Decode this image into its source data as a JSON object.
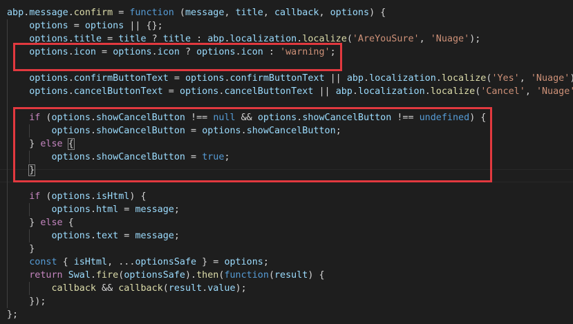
{
  "colors": {
    "background": "#1e1e1e",
    "highlight_box": "#e2393f",
    "identifier": "#9cdcfe",
    "function_name": "#dcdcaa",
    "keyword_control": "#c586c0",
    "keyword_storage": "#569cd6",
    "string": "#ce9178",
    "punctuation": "#d4d4d4",
    "class_name": "#4ec9b0"
  },
  "code_lines": [
    {
      "indent": 0,
      "tokens": [
        {
          "t": "abp",
          "c": "identifier"
        },
        {
          "t": ".",
          "c": "punctuation"
        },
        {
          "t": "message",
          "c": "identifier"
        },
        {
          "t": ".",
          "c": "punctuation"
        },
        {
          "t": "confirm",
          "c": "function_name"
        },
        {
          "t": " = ",
          "c": "punctuation"
        },
        {
          "t": "function",
          "c": "keyword_storage"
        },
        {
          "t": " (",
          "c": "punctuation"
        },
        {
          "t": "message",
          "c": "identifier"
        },
        {
          "t": ", ",
          "c": "punctuation"
        },
        {
          "t": "title",
          "c": "identifier"
        },
        {
          "t": ", ",
          "c": "punctuation"
        },
        {
          "t": "callback",
          "c": "identifier"
        },
        {
          "t": ", ",
          "c": "punctuation"
        },
        {
          "t": "options",
          "c": "identifier"
        },
        {
          "t": ") {",
          "c": "punctuation"
        }
      ]
    },
    {
      "indent": 1,
      "tokens": [
        {
          "t": "options",
          "c": "identifier"
        },
        {
          "t": " = ",
          "c": "punctuation"
        },
        {
          "t": "options",
          "c": "identifier"
        },
        {
          "t": " || {};",
          "c": "punctuation"
        }
      ]
    },
    {
      "indent": 1,
      "tokens": [
        {
          "t": "options",
          "c": "identifier"
        },
        {
          "t": ".",
          "c": "punctuation"
        },
        {
          "t": "title",
          "c": "identifier"
        },
        {
          "t": " = ",
          "c": "punctuation"
        },
        {
          "t": "title",
          "c": "identifier"
        },
        {
          "t": " ? ",
          "c": "punctuation"
        },
        {
          "t": "title",
          "c": "identifier"
        },
        {
          "t": " : ",
          "c": "punctuation"
        },
        {
          "t": "abp",
          "c": "identifier"
        },
        {
          "t": ".",
          "c": "punctuation"
        },
        {
          "t": "localization",
          "c": "identifier"
        },
        {
          "t": ".",
          "c": "punctuation"
        },
        {
          "t": "localize",
          "c": "function_name"
        },
        {
          "t": "(",
          "c": "punctuation"
        },
        {
          "t": "'AreYouSure'",
          "c": "string"
        },
        {
          "t": ", ",
          "c": "punctuation"
        },
        {
          "t": "'Nuage'",
          "c": "string"
        },
        {
          "t": ");",
          "c": "punctuation"
        }
      ]
    },
    {
      "indent": 1,
      "tokens": [
        {
          "t": "options",
          "c": "identifier"
        },
        {
          "t": ".",
          "c": "punctuation"
        },
        {
          "t": "icon",
          "c": "identifier"
        },
        {
          "t": " = ",
          "c": "punctuation"
        },
        {
          "t": "options",
          "c": "identifier"
        },
        {
          "t": ".",
          "c": "punctuation"
        },
        {
          "t": "icon",
          "c": "identifier"
        },
        {
          "t": " ? ",
          "c": "punctuation"
        },
        {
          "t": "options",
          "c": "identifier"
        },
        {
          "t": ".",
          "c": "punctuation"
        },
        {
          "t": "icon",
          "c": "identifier"
        },
        {
          "t": " : ",
          "c": "punctuation"
        },
        {
          "t": "'warning'",
          "c": "string"
        },
        {
          "t": ";",
          "c": "punctuation"
        }
      ]
    },
    {
      "indent": 0,
      "tokens": []
    },
    {
      "indent": 1,
      "tokens": [
        {
          "t": "options",
          "c": "identifier"
        },
        {
          "t": ".",
          "c": "punctuation"
        },
        {
          "t": "confirmButtonText",
          "c": "identifier"
        },
        {
          "t": " = ",
          "c": "punctuation"
        },
        {
          "t": "options",
          "c": "identifier"
        },
        {
          "t": ".",
          "c": "punctuation"
        },
        {
          "t": "confirmButtonText",
          "c": "identifier"
        },
        {
          "t": " || ",
          "c": "punctuation"
        },
        {
          "t": "abp",
          "c": "identifier"
        },
        {
          "t": ".",
          "c": "punctuation"
        },
        {
          "t": "localization",
          "c": "identifier"
        },
        {
          "t": ".",
          "c": "punctuation"
        },
        {
          "t": "localize",
          "c": "function_name"
        },
        {
          "t": "(",
          "c": "punctuation"
        },
        {
          "t": "'Yes'",
          "c": "string"
        },
        {
          "t": ", ",
          "c": "punctuation"
        },
        {
          "t": "'Nuage'",
          "c": "string"
        },
        {
          "t": ");",
          "c": "punctuation"
        }
      ]
    },
    {
      "indent": 1,
      "tokens": [
        {
          "t": "options",
          "c": "identifier"
        },
        {
          "t": ".",
          "c": "punctuation"
        },
        {
          "t": "cancelButtonText",
          "c": "identifier"
        },
        {
          "t": " = ",
          "c": "punctuation"
        },
        {
          "t": "options",
          "c": "identifier"
        },
        {
          "t": ".",
          "c": "punctuation"
        },
        {
          "t": "cancelButtonText",
          "c": "identifier"
        },
        {
          "t": " || ",
          "c": "punctuation"
        },
        {
          "t": "abp",
          "c": "identifier"
        },
        {
          "t": ".",
          "c": "punctuation"
        },
        {
          "t": "localization",
          "c": "identifier"
        },
        {
          "t": ".",
          "c": "punctuation"
        },
        {
          "t": "localize",
          "c": "function_name"
        },
        {
          "t": "(",
          "c": "punctuation"
        },
        {
          "t": "'Cancel'",
          "c": "string"
        },
        {
          "t": ", ",
          "c": "punctuation"
        },
        {
          "t": "'Nuage'",
          "c": "string"
        },
        {
          "t": ");",
          "c": "punctuation"
        }
      ]
    },
    {
      "indent": 0,
      "tokens": []
    },
    {
      "indent": 1,
      "tokens": [
        {
          "t": "if",
          "c": "keyword_control"
        },
        {
          "t": " (",
          "c": "punctuation"
        },
        {
          "t": "options",
          "c": "identifier"
        },
        {
          "t": ".",
          "c": "punctuation"
        },
        {
          "t": "showCancelButton",
          "c": "identifier"
        },
        {
          "t": " !== ",
          "c": "punctuation"
        },
        {
          "t": "null",
          "c": "keyword_storage"
        },
        {
          "t": " && ",
          "c": "punctuation"
        },
        {
          "t": "options",
          "c": "identifier"
        },
        {
          "t": ".",
          "c": "punctuation"
        },
        {
          "t": "showCancelButton",
          "c": "identifier"
        },
        {
          "t": " !== ",
          "c": "punctuation"
        },
        {
          "t": "undefined",
          "c": "keyword_storage"
        },
        {
          "t": ") {",
          "c": "punctuation"
        }
      ]
    },
    {
      "indent": 2,
      "tokens": [
        {
          "t": "options",
          "c": "identifier"
        },
        {
          "t": ".",
          "c": "punctuation"
        },
        {
          "t": "showCancelButton",
          "c": "identifier"
        },
        {
          "t": " = ",
          "c": "punctuation"
        },
        {
          "t": "options",
          "c": "identifier"
        },
        {
          "t": ".",
          "c": "punctuation"
        },
        {
          "t": "showCancelButton",
          "c": "identifier"
        },
        {
          "t": ";",
          "c": "punctuation"
        }
      ]
    },
    {
      "indent": 1,
      "tokens": [
        {
          "t": "} ",
          "c": "punctuation"
        },
        {
          "t": "else",
          "c": "keyword_control"
        },
        {
          "t": " ",
          "c": "punctuation"
        },
        {
          "t": "{",
          "c": "punctuation",
          "match": true
        }
      ]
    },
    {
      "indent": 2,
      "tokens": [
        {
          "t": "options",
          "c": "identifier"
        },
        {
          "t": ".",
          "c": "punctuation"
        },
        {
          "t": "showCancelButton",
          "c": "identifier"
        },
        {
          "t": " = ",
          "c": "punctuation"
        },
        {
          "t": "true",
          "c": "keyword_storage"
        },
        {
          "t": ";",
          "c": "punctuation"
        }
      ]
    },
    {
      "indent": 1,
      "tokens": [
        {
          "t": "}",
          "c": "punctuation",
          "match": true
        }
      ]
    },
    {
      "indent": 0,
      "tokens": []
    },
    {
      "indent": 1,
      "tokens": [
        {
          "t": "if",
          "c": "keyword_control"
        },
        {
          "t": " (",
          "c": "punctuation"
        },
        {
          "t": "options",
          "c": "identifier"
        },
        {
          "t": ".",
          "c": "punctuation"
        },
        {
          "t": "isHtml",
          "c": "identifier"
        },
        {
          "t": ") {",
          "c": "punctuation"
        }
      ]
    },
    {
      "indent": 2,
      "tokens": [
        {
          "t": "options",
          "c": "identifier"
        },
        {
          "t": ".",
          "c": "punctuation"
        },
        {
          "t": "html",
          "c": "identifier"
        },
        {
          "t": " = ",
          "c": "punctuation"
        },
        {
          "t": "message",
          "c": "identifier"
        },
        {
          "t": ";",
          "c": "punctuation"
        }
      ]
    },
    {
      "indent": 1,
      "tokens": [
        {
          "t": "} ",
          "c": "punctuation"
        },
        {
          "t": "else",
          "c": "keyword_control"
        },
        {
          "t": " {",
          "c": "punctuation"
        }
      ]
    },
    {
      "indent": 2,
      "tokens": [
        {
          "t": "options",
          "c": "identifier"
        },
        {
          "t": ".",
          "c": "punctuation"
        },
        {
          "t": "text",
          "c": "identifier"
        },
        {
          "t": " = ",
          "c": "punctuation"
        },
        {
          "t": "message",
          "c": "identifier"
        },
        {
          "t": ";",
          "c": "punctuation"
        }
      ]
    },
    {
      "indent": 1,
      "tokens": [
        {
          "t": "}",
          "c": "punctuation"
        }
      ]
    },
    {
      "indent": 1,
      "tokens": [
        {
          "t": "const",
          "c": "keyword_storage"
        },
        {
          "t": " { ",
          "c": "punctuation"
        },
        {
          "t": "isHtml",
          "c": "identifier"
        },
        {
          "t": ", ...",
          "c": "punctuation"
        },
        {
          "t": "optionsSafe",
          "c": "identifier"
        },
        {
          "t": " } = ",
          "c": "punctuation"
        },
        {
          "t": "options",
          "c": "identifier"
        },
        {
          "t": ";",
          "c": "punctuation"
        }
      ]
    },
    {
      "indent": 1,
      "tokens": [
        {
          "t": "return",
          "c": "keyword_control"
        },
        {
          "t": " ",
          "c": "punctuation"
        },
        {
          "t": "Swal",
          "c": "identifier"
        },
        {
          "t": ".",
          "c": "punctuation"
        },
        {
          "t": "fire",
          "c": "function_name"
        },
        {
          "t": "(",
          "c": "punctuation"
        },
        {
          "t": "optionsSafe",
          "c": "identifier"
        },
        {
          "t": ").",
          "c": "punctuation"
        },
        {
          "t": "then",
          "c": "function_name"
        },
        {
          "t": "(",
          "c": "punctuation"
        },
        {
          "t": "function",
          "c": "keyword_storage"
        },
        {
          "t": "(",
          "c": "punctuation"
        },
        {
          "t": "result",
          "c": "identifier"
        },
        {
          "t": ") {",
          "c": "punctuation"
        }
      ]
    },
    {
      "indent": 2,
      "tokens": [
        {
          "t": "callback",
          "c": "function_name"
        },
        {
          "t": " && ",
          "c": "punctuation"
        },
        {
          "t": "callback",
          "c": "function_name"
        },
        {
          "t": "(",
          "c": "punctuation"
        },
        {
          "t": "result",
          "c": "identifier"
        },
        {
          "t": ".",
          "c": "punctuation"
        },
        {
          "t": "value",
          "c": "identifier"
        },
        {
          "t": ");",
          "c": "punctuation"
        }
      ]
    },
    {
      "indent": 1,
      "tokens": [
        {
          "t": "});",
          "c": "punctuation"
        }
      ]
    },
    {
      "indent": 0,
      "tokens": [
        {
          "t": "};",
          "c": "punctuation"
        }
      ]
    }
  ]
}
